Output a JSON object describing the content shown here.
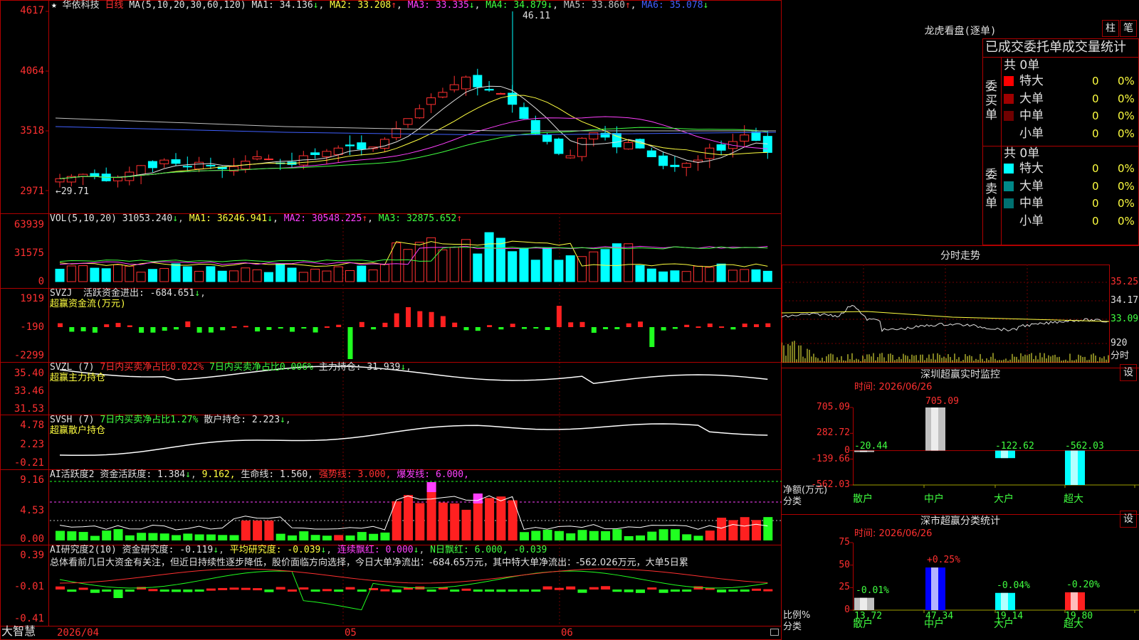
{
  "stock": {
    "name": "华依科技",
    "period": "日线",
    "star": "★"
  },
  "kline": {
    "ma_header": "MA(5,10,20,30,60,120)",
    "ma": [
      {
        "label": "MA1:",
        "value": "34.136",
        "arrow": "↓",
        "color": "#e0e0e0"
      },
      {
        "label": "MA2:",
        "value": "33.208",
        "arrow": "↑",
        "color": "#ffff40"
      },
      {
        "label": "MA3:",
        "value": "33.335",
        "arrow": "↓",
        "color": "#ff40ff"
      },
      {
        "label": "MA4:",
        "value": "34.879",
        "arrow": "↓",
        "color": "#40ff40"
      },
      {
        "label": "MA5:",
        "value": "33.860",
        "arrow": "↑",
        "color": "#c0c0c0"
      },
      {
        "label": "MA6:",
        "value": "35.078",
        "arrow": "↓",
        "color": "#4060ff"
      }
    ],
    "y_ticks": [
      "4617",
      "4064",
      "3518",
      "2971"
    ],
    "high_label": "46.11",
    "low_label": "←29.71"
  },
  "vol": {
    "header": "VOL(5,10,20)",
    "value": "31053.240",
    "value_arrow": "↓",
    "ma": [
      {
        "label": "MA1:",
        "value": "36246.941",
        "arrow": "↓",
        "color": "#ffff40"
      },
      {
        "label": "MA2:",
        "value": "30548.225",
        "arrow": "↑",
        "color": "#ff40ff"
      },
      {
        "label": "MA3:",
        "value": "32875.652",
        "arrow": "↑",
        "color": "#40ff40"
      }
    ],
    "y_ticks": [
      "63939",
      "31575",
      "0"
    ]
  },
  "svzj": {
    "header": "SVZJ",
    "line1_label": "活跃资金进出:",
    "line1_value": "-684.651",
    "arrow": "↓",
    "sub": "超赢资金流(万元)",
    "y_ticks": [
      "1919",
      "-190",
      "-2299"
    ]
  },
  "svzl": {
    "header": "SVZL (7)",
    "t1": "7日内买卖净占比0.022%",
    "t2": "7日内买卖净占比0.006%",
    "t3": "主力持仓: 31.939",
    "arrow": "↓",
    "sub": "超赢主力持仓",
    "y_ticks": [
      "35.40",
      "33.46",
      "31.53"
    ]
  },
  "svsh": {
    "header": "SVSH (7)",
    "t1": "7日内买卖净占比1.27%",
    "t2": "散户持仓: 2.223",
    "arrow": "↓",
    "sub": "超赢散户持仓",
    "y_ticks": [
      "4.78",
      "2.23",
      "-0.21"
    ]
  },
  "ai_active": {
    "header": "AI活跃度2",
    "t1": "资金活跃度: 1.384",
    "a1": "↓",
    "t2": "9.162,",
    "t3": "生命线: 1.560,",
    "t4": "强势线: 3.000,",
    "t5": "爆发线: 6.000,",
    "y_ticks": [
      "9.16",
      "4.53",
      "0.00"
    ]
  },
  "ai_research": {
    "header": "AI研究度2(10)",
    "t1": "资金研究度: -0.119",
    "t2": "平均研究度: -0.039",
    "t3": "连续飘红: 0.000",
    "t4": "N日飘红: 6.000, -0.039",
    "summary": "总体看前几日大资金有关注，但近日持续性逐步降低，股价面临方向选择，今日大单净流出：-684.65万元，其中特大单净流出：-562.026万元，大单5日累",
    "y_ticks": [
      "0.39",
      "-0.01",
      "-0.41"
    ]
  },
  "footer": {
    "brand": "大智慧",
    "date": "2026/04",
    "m1": "05",
    "m2": "06"
  },
  "dragon": {
    "title": "龙虎看盘(逐单)",
    "btn1": "柱",
    "btn2": "笔",
    "header": "已成交委托单成交量统计",
    "buy_label": "委买单",
    "sell_label": "委卖单",
    "buy_total": "共 0单",
    "sell_total": "共 0单",
    "buy_rows": [
      {
        "name": "特大",
        "count": "0",
        "pct": "0%",
        "color": "#ff0000"
      },
      {
        "name": "大单",
        "count": "0",
        "pct": "0%",
        "color": "#a00000"
      },
      {
        "name": "中单",
        "count": "0",
        "pct": "0%",
        "color": "#700000"
      },
      {
        "name": "小单",
        "count": "0",
        "pct": "0%",
        "color": "#000000"
      }
    ],
    "sell_rows": [
      {
        "name": "特大",
        "count": "0",
        "pct": "0%",
        "color": "#00ffff"
      },
      {
        "name": "大单",
        "count": "0",
        "pct": "0%",
        "color": "#008888"
      },
      {
        "name": "中单",
        "count": "0",
        "pct": "0%",
        "color": "#007070"
      },
      {
        "name": "小单",
        "count": "0",
        "pct": "0%",
        "color": "#000000"
      }
    ]
  },
  "intraday": {
    "title": "分时走势",
    "prices": [
      "35.25",
      "34.17",
      "33.09"
    ],
    "vol_label": "920",
    "time_label": "分时"
  },
  "monitor": {
    "title": "深圳超赢实时监控",
    "btn": "设",
    "time": "时间: 2026/06/26",
    "y_ticks": [
      "705.09",
      "282.72",
      "0",
      "-139.66",
      "-562.03"
    ],
    "y_unit": "净额(万元)",
    "x_unit": "分类",
    "chart_data": {
      "type": "bar",
      "categories": [
        "散户",
        "中户",
        "大户",
        "超大"
      ],
      "values": [
        -20.44,
        705.09,
        -122.62,
        -562.03
      ],
      "labels": [
        "-20.44",
        "705.09",
        "-122.62",
        "-562.03"
      ],
      "ylim": [
        -562.03,
        705.09
      ]
    }
  },
  "classify": {
    "title": "深市超赢分类统计",
    "btn": "设",
    "time": "时间: 2026/06/26",
    "y_ticks": [
      "75",
      "50",
      "25",
      "0"
    ],
    "y_unit": "比例%",
    "x_unit": "分类",
    "chart_data": {
      "type": "bar",
      "categories": [
        "散户",
        "中户",
        "大户",
        "超大"
      ],
      "values": [
        13.72,
        47.34,
        19.14,
        19.8
      ],
      "changes": [
        "-0.01%",
        "+0.25%",
        "-0.04%",
        "-0.20%"
      ],
      "value_labels": [
        "13.72",
        "47.34",
        "19.14",
        "19.80"
      ],
      "ylim": [
        0,
        75
      ]
    }
  }
}
